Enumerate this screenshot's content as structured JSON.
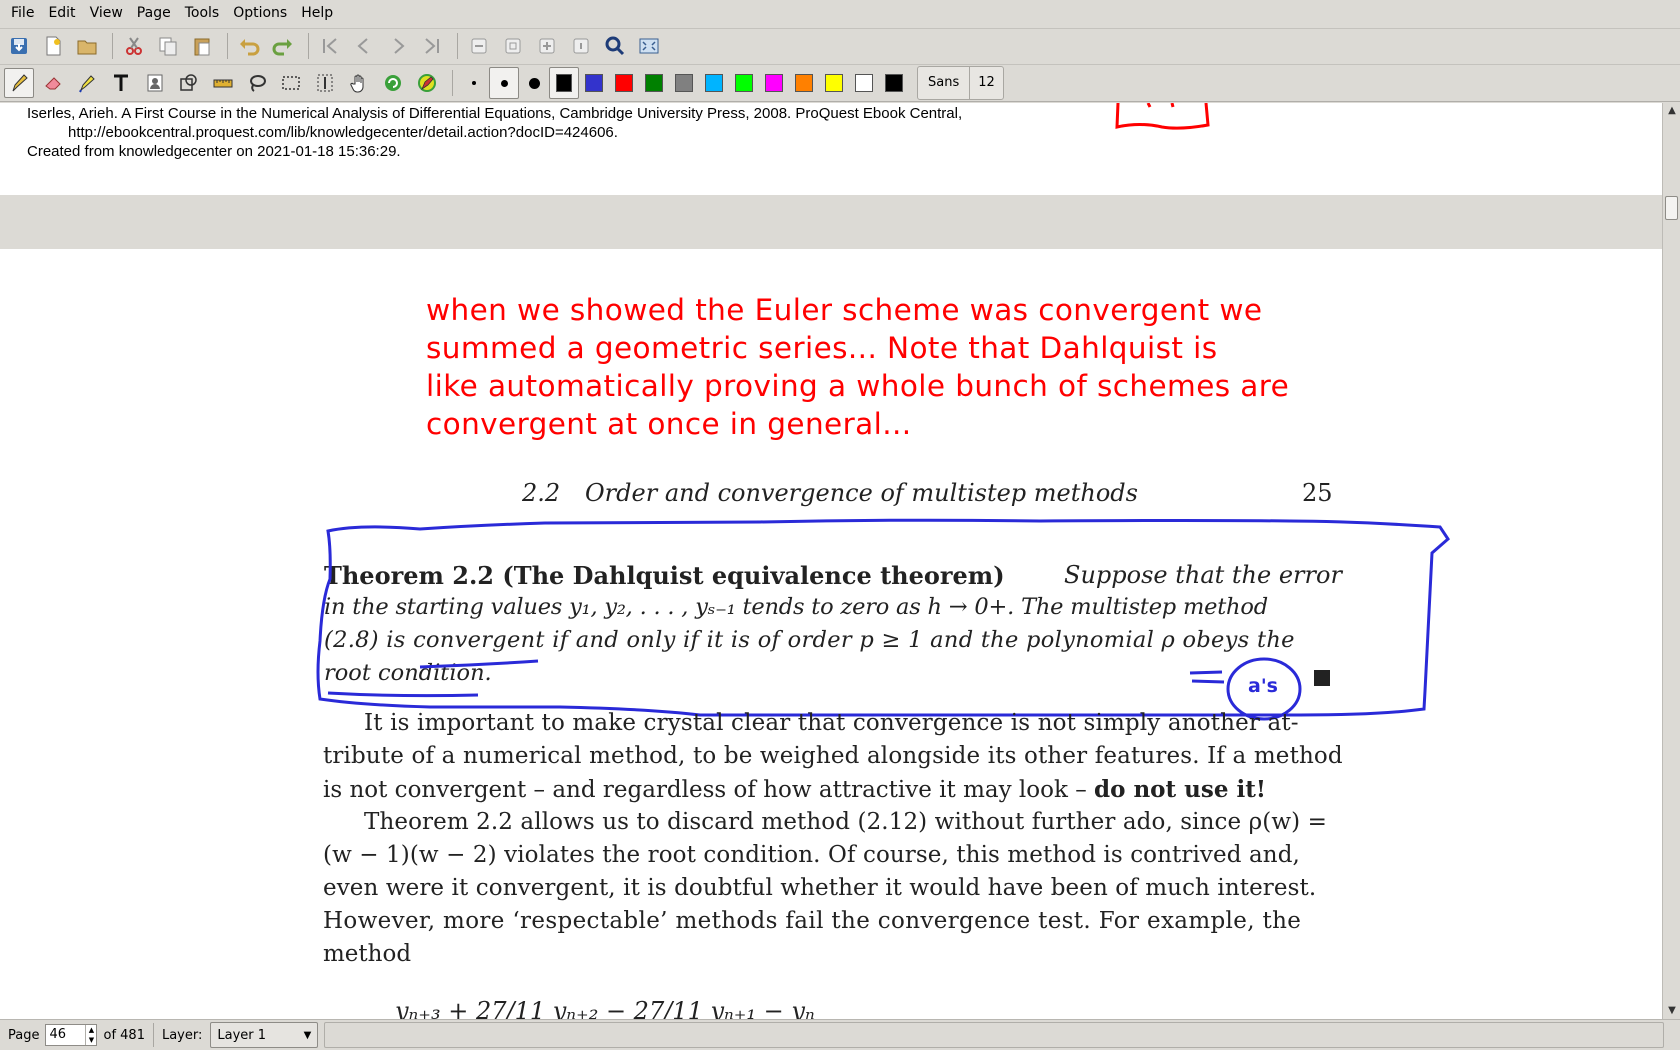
{
  "menu": [
    "File",
    "Edit",
    "View",
    "Page",
    "Tools",
    "Options",
    "Help"
  ],
  "toolbar1": {
    "buttons": [
      "save-icon",
      "new-icon",
      "open-icon",
      "cut-icon",
      "copy-icon",
      "paste-icon",
      "undo-icon",
      "redo-icon",
      "first-page-icon",
      "prev-page-icon",
      "next-page-icon",
      "last-page-icon",
      "delete-page-icon",
      "new-page-before-icon",
      "new-page-after-icon",
      "new-page-end-icon",
      "zoom-icon",
      "fullscreen-icon"
    ]
  },
  "toolbar2": {
    "tools": [
      "pen-icon",
      "eraser-icon",
      "highlighter-icon",
      "text-icon",
      "image-icon",
      "shape-recognizer-icon",
      "ruler-icon",
      "lasso-icon",
      "select-rect-icon",
      "vertical-space-icon",
      "hand-icon",
      "refresh-icon",
      "default-pen-icon"
    ],
    "thickness": [
      "thin",
      "medium",
      "thick"
    ],
    "colors": [
      "#000000",
      "#3333cc",
      "#ff0000",
      "#008000",
      "#808080",
      "#00b4ff",
      "#00ff00",
      "#ff00ff",
      "#ff8000",
      "#ffff00",
      "#ffffff",
      "#000000"
    ],
    "font_name": "Sans",
    "font_size": "12"
  },
  "document": {
    "source_line1": "Iserles, Arieh. A First Course in the Numerical Analysis of Differential Equations, Cambridge University Press, 2008. ProQuest Ebook Central,",
    "source_line2": "http://ebookcentral.proquest.com/lib/knowledgecenter/detail.action?docID=424606.",
    "source_line3": "Created from knowledgecenter on 2021-01-18 15:36:29.",
    "annotation_lines": [
      "when we showed the Euler scheme was convergent we",
      "summed a geometric series...      Note that Dahlquist is",
      "like automatically proving a whole bunch of schemes are",
      "convergent at once in general..."
    ],
    "header_section": "2.2",
    "header_title": "Order and convergence of multistep methods",
    "header_page": "25",
    "theorem_label": "Theorem 2.2 (The Dahlquist equivalence theorem)",
    "theorem_l1_tail": "Suppose that the error",
    "theorem_l2": "in the starting values y₁, y₂, . . . , yₛ₋₁ tends to zero as h → 0+. The multistep method",
    "theorem_l3": "(2.8) is convergent if and only if it is of order p ≥ 1 and the polynomial ρ obeys the",
    "theorem_l4": "root condition.",
    "handwritten_note": "a's",
    "para_lines": [
      "It is important to make crystal clear that convergence is not simply another at-",
      "tribute of a numerical method, to be weighed alongside its other features. If a method",
      "is not convergent – and regardless of how attractive it may look – ",
      "Theorem 2.2 allows us to discard method (2.12) without further ado, since ρ(w) =",
      "(w − 1)(w − 2) violates the root condition. Of course, this method is contrived and,",
      "even were it convergent, it is doubtful whether it would have been of much interest.",
      "However, more ‘respectable’ methods fail the convergence test.  For example, the",
      "method"
    ],
    "para_bold": "do not use it!",
    "equation_partial": "yₙ₊₃ + 27/11 yₙ₊₂ − 27/11 yₙ₊₁ − yₙ"
  },
  "status": {
    "page_label": "Page",
    "page_value": "46",
    "page_of": "of 481",
    "layer_label": "Layer:",
    "layer_value": "Layer 1"
  }
}
